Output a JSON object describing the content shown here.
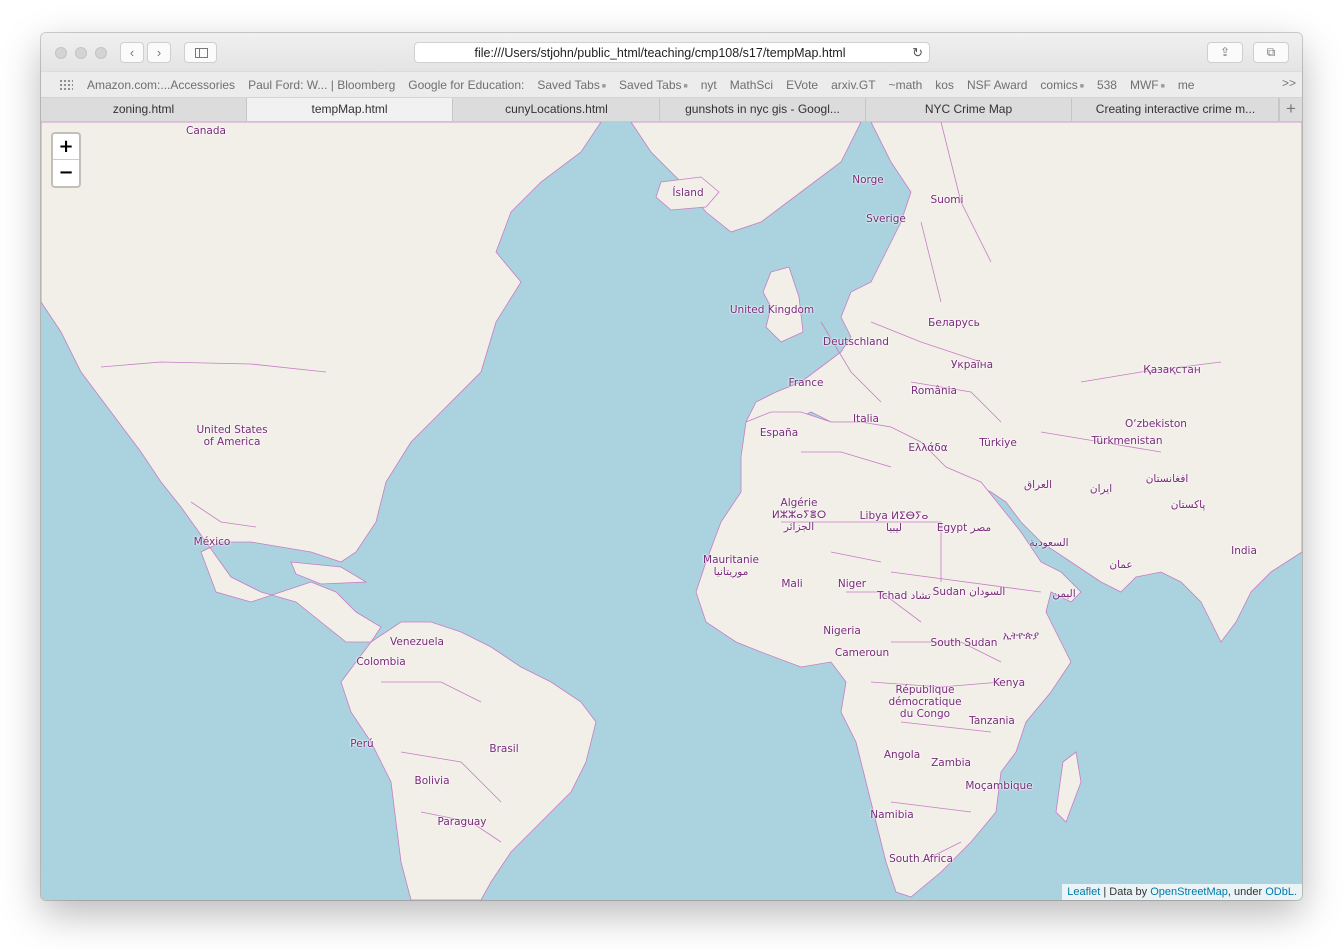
{
  "browser": {
    "url": "file:///Users/stjohn/public_html/teaching/cmp108/s17/tempMap.html",
    "back_glyph": "‹",
    "forward_glyph": "›",
    "reload_glyph": "↻",
    "share_glyph": "⇪",
    "tabs_glyph": "⧉",
    "icons": [
      "close-icon",
      "minimize-icon",
      "zoom-icon",
      "back-icon",
      "forward-icon",
      "sidebar-icon",
      "reload-icon",
      "share-icon",
      "show-tabs-icon"
    ]
  },
  "bookmarks": {
    "items": [
      {
        "label": "Amazon.com:...Accessories",
        "folder": false
      },
      {
        "label": "Paul Ford: W... | Bloomberg",
        "folder": false
      },
      {
        "label": "Google for Education:",
        "folder": false
      },
      {
        "label": "Saved Tabs",
        "folder": true
      },
      {
        "label": "Saved Tabs",
        "folder": true
      },
      {
        "label": "nyt",
        "folder": false
      },
      {
        "label": "MathSci",
        "folder": false
      },
      {
        "label": "EVote",
        "folder": false
      },
      {
        "label": "arxiv.GT",
        "folder": false
      },
      {
        "label": "~math",
        "folder": false
      },
      {
        "label": "kos",
        "folder": false
      },
      {
        "label": "NSF Award",
        "folder": false
      },
      {
        "label": "comics",
        "folder": true
      },
      {
        "label": "538",
        "folder": false
      },
      {
        "label": "MWF",
        "folder": true
      },
      {
        "label": "me",
        "folder": false
      }
    ],
    "more": ">>"
  },
  "tabs": [
    {
      "label": "zoning.html",
      "active": false
    },
    {
      "label": "tempMap.html",
      "active": true
    },
    {
      "label": "cunyLocations.html",
      "active": false
    },
    {
      "label": "gunshots in nyc gis - Googl...",
      "active": false
    },
    {
      "label": "NYC Crime Map",
      "active": false
    },
    {
      "label": "Creating interactive crime m...",
      "active": false
    }
  ],
  "tab_add": "+",
  "map": {
    "colors": {
      "water": "#aad3df",
      "land": "#f2efe9",
      "border": "#c77dc4",
      "label": "#7a2a7a"
    },
    "zoom_in": "+",
    "zoom_out": "−",
    "labels": [
      "Canada",
      "Ísland",
      "Norge",
      "Suomi",
      "Sverige",
      "United Kingdom",
      "Беларусь",
      "Deutschland",
      "Україна",
      "France",
      "România",
      "Қазақстан",
      "Italia",
      "España",
      "Türkiye",
      "Ελλάδα",
      "O‘zbekiston",
      "Türkmenistan",
      "United States\nof America",
      "العراق",
      "ایران",
      "افغانستان",
      "Algérie\nⵍⵣⵣⴰⵢⴻⵔ\nالجزائر",
      "Libya ⵍⵉⴱⵢⴰ\nليبيا",
      "Egypt مصر",
      "پاکستان",
      "México",
      "السعودية",
      "India",
      "عمان",
      "Mauritanie\nموريتانيا",
      "Mali",
      "Niger",
      "Tchad تشاد",
      "Sudan السودان",
      "اليمن",
      "Venezuela",
      "Nigeria",
      "South Sudan",
      "ኢትዮጵያ",
      "Colombia",
      "Cameroun",
      "Kenya",
      "République\ndémocratique\ndu Congo",
      "Tanzania",
      "Perú",
      "Brasil",
      "Angola",
      "Zambia",
      "Bolivia",
      "Moçambique",
      "Namibia",
      "Paraguay",
      "South Africa"
    ]
  },
  "attribution": {
    "leaflet": "Leaflet",
    "sep": " | Data by ",
    "osm": "OpenStreetMap",
    "under": ", under ",
    "license": "ODbL."
  }
}
